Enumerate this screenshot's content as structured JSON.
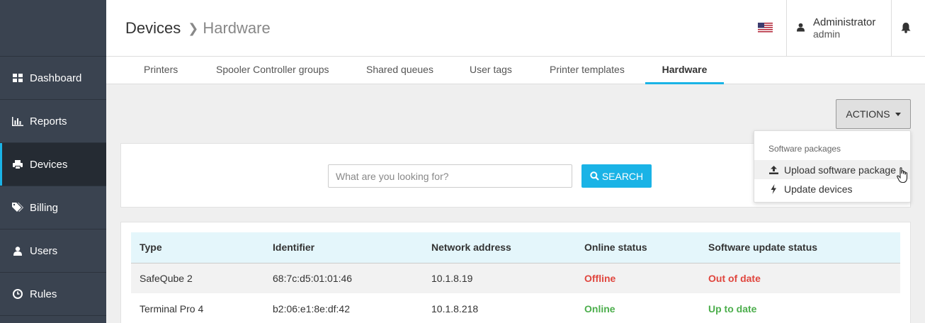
{
  "sidebar": {
    "items": [
      {
        "label": "Dashboard",
        "icon": "dashboard-icon"
      },
      {
        "label": "Reports",
        "icon": "bar-chart-icon"
      },
      {
        "label": "Devices",
        "icon": "printer-icon"
      },
      {
        "label": "Billing",
        "icon": "tags-icon"
      },
      {
        "label": "Users",
        "icon": "user-icon"
      },
      {
        "label": "Rules",
        "icon": "clock-icon"
      }
    ],
    "active": "Devices"
  },
  "header": {
    "breadcrumb": [
      "Devices",
      "Hardware"
    ],
    "user_name": "Administrator",
    "user_role": "admin"
  },
  "tabs": [
    "Printers",
    "Spooler Controller groups",
    "Shared queues",
    "User tags",
    "Printer templates",
    "Hardware"
  ],
  "active_tab": "Hardware",
  "actions": {
    "label": "ACTIONS"
  },
  "dropdown": {
    "header": "Software packages",
    "items": [
      "Upload software package",
      "Update devices"
    ]
  },
  "search": {
    "placeholder": "What are you looking for?",
    "button": "SEARCH"
  },
  "table": {
    "columns": [
      "Type",
      "Identifier",
      "Network address",
      "Online status",
      "Software update status"
    ],
    "rows": [
      [
        "SafeQube 2",
        "68:7c:d5:01:01:46",
        "10.1.8.19",
        "Offline",
        "Out of date"
      ],
      [
        "Terminal Pro 4",
        "b2:06:e1:8e:df:42",
        "10.1.8.218",
        "Online",
        "Up to date"
      ]
    ]
  },
  "colors": {
    "accent": "#1ab3e6",
    "sidebar": "#3a4350",
    "status_bad": "#e0463e",
    "status_good": "#4cae4c"
  }
}
